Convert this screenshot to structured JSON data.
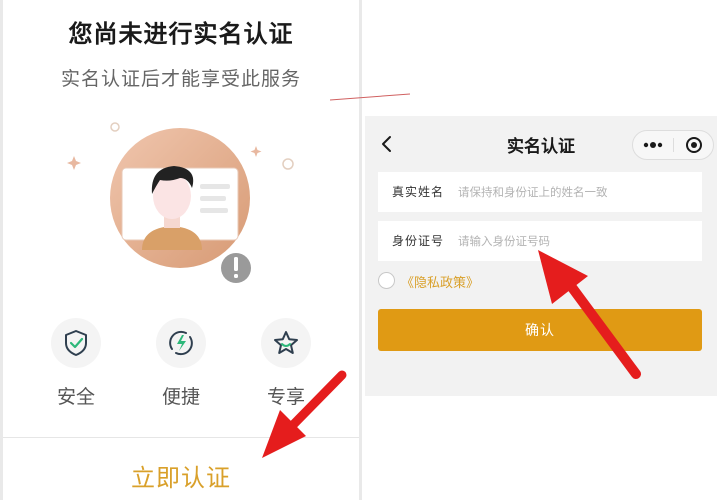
{
  "left": {
    "title": "您尚未进行实名认证",
    "subtitle": "实名认证后才能享受此服务",
    "features": [
      {
        "label": "安全",
        "icon": "shield-check-icon"
      },
      {
        "label": "便捷",
        "icon": "lightning-icon"
      },
      {
        "label": "专享",
        "icon": "star-icon"
      }
    ],
    "verify_button": "立即认证"
  },
  "right": {
    "nav_title": "实名认证",
    "form": {
      "name_label": "真实姓名",
      "name_placeholder": "请保持和身份证上的姓名一致",
      "id_label": "身份证号",
      "id_placeholder": "请输入身份证号码"
    },
    "privacy_link": "《隐私政策》",
    "confirm_button": "确认"
  },
  "colors": {
    "accent": "#e09a14",
    "accent_text": "#d9a02a",
    "annotation_arrow": "#e51d1d"
  }
}
